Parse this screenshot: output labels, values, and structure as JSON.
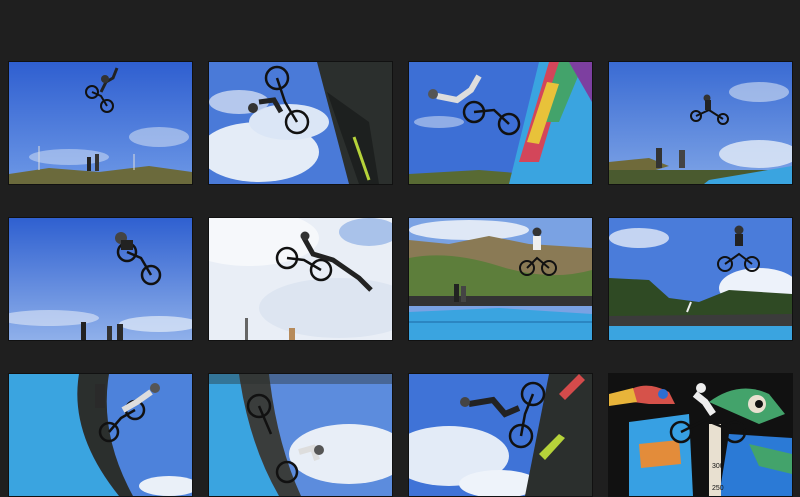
{
  "gallery": {
    "photos": [
      {
        "subject": "bmx-rider-airborne-blue-sky"
      },
      {
        "subject": "bmx-rider-inverted-beside-ramp"
      },
      {
        "subject": "bmx-rider-over-graffiti-ramp"
      },
      {
        "subject": "bmx-rider-high-air-crowd-below"
      },
      {
        "subject": "bmx-rider-tuck-trick"
      },
      {
        "subject": "bmx-rider-superman-cloudy-sky"
      },
      {
        "subject": "bmx-rider-over-blue-ramps-hillside"
      },
      {
        "subject": "bmx-rider-above-crowd-and-trees"
      },
      {
        "subject": "bmx-rider-on-blue-vert-wall"
      },
      {
        "subject": "bmx-rider-on-quarter-pipe"
      },
      {
        "subject": "bmx-rider-upside-down-vert"
      },
      {
        "subject": "bmx-rider-in-front-of-bird-mural"
      }
    ]
  },
  "mural": {
    "height_marks": [
      "300",
      "250"
    ]
  },
  "colors": {
    "background": "#1f1f1f",
    "sky": "#3f6fd6",
    "ramp_blue": "#3aa4e0",
    "hill_green": "#5e7f3a"
  }
}
